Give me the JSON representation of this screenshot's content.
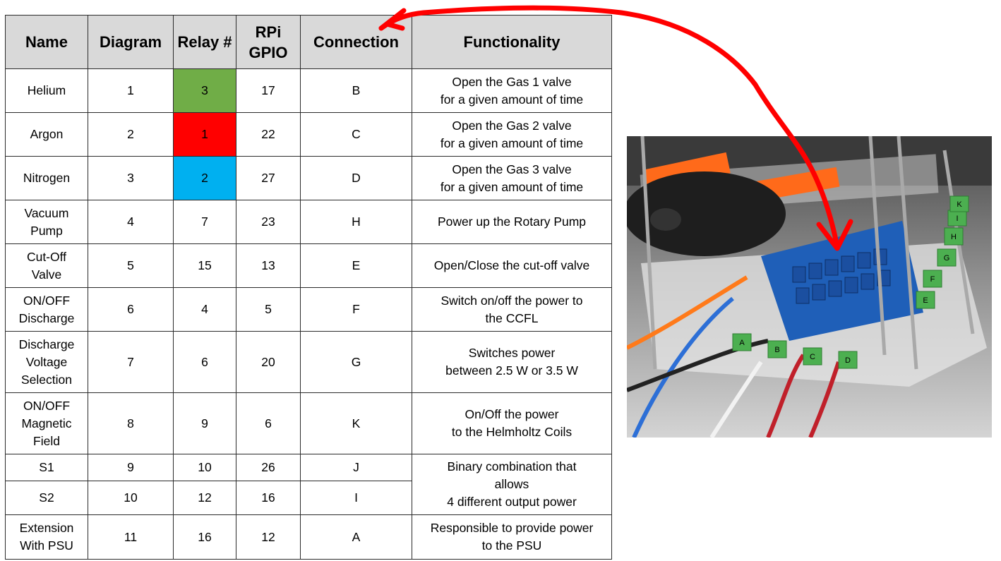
{
  "table": {
    "headers": [
      "Name",
      "Diagram",
      "Relay\n#",
      "RPi\nGPIO",
      "Connection",
      "Functionality"
    ],
    "rows": [
      {
        "name": "Helium",
        "diagram": "1",
        "relay": "3",
        "gpio": "17",
        "connection": "B",
        "functionality": "Open the Gas 1 valve\nfor a given amount of time",
        "relay_color": "#70ad47"
      },
      {
        "name": "Argon",
        "diagram": "2",
        "relay": "1",
        "gpio": "22",
        "connection": "C",
        "functionality": "Open the Gas 2 valve\nfor a given amount of time",
        "relay_color": "#ff0000"
      },
      {
        "name": "Nitrogen",
        "diagram": "3",
        "relay": "2",
        "gpio": "27",
        "connection": "D",
        "functionality": "Open the Gas 3 valve\nfor a given amount of time",
        "relay_color": "#00b0f0"
      },
      {
        "name": "Vacuum\nPump",
        "diagram": "4",
        "relay": "7",
        "gpio": "23",
        "connection": "H",
        "functionality": "Power up the Rotary Pump"
      },
      {
        "name": "Cut-Off\nValve",
        "diagram": "5",
        "relay": "15",
        "gpio": "13",
        "connection": "E",
        "functionality": "Open/Close the cut-off valve"
      },
      {
        "name": "ON/OFF\nDischarge",
        "diagram": "6",
        "relay": "4",
        "gpio": "5",
        "connection": "F",
        "functionality": "Switch on/off the power to\nthe CCFL"
      },
      {
        "name": "Discharge\nVoltage\nSelection",
        "diagram": "7",
        "relay": "6",
        "gpio": "20",
        "connection": "G",
        "functionality": "Switches power\nbetween 2.5 W or 3.5 W"
      },
      {
        "name": "ON/OFF\nMagnetic\nField",
        "diagram": "8",
        "relay": "9",
        "gpio": "6",
        "connection": "K",
        "functionality": "On/Off the power\nto the Helmholtz Coils"
      },
      {
        "name": "S1",
        "diagram": "9",
        "relay": "10",
        "gpio": "26",
        "connection": "J",
        "functionality": "Binary combination that\nallows\n4 different output power"
      },
      {
        "name": "S2",
        "diagram": "10",
        "relay": "12",
        "gpio": "16",
        "connection": "I"
      },
      {
        "name": "Extension\nWith PSU",
        "diagram": "11",
        "relay": "16",
        "gpio": "12",
        "connection": "A",
        "functionality": "Responsible to provide power\nto the PSU"
      }
    ]
  },
  "photo": {
    "connector_labels": [
      "A",
      "B",
      "C",
      "D",
      "E",
      "F",
      "G",
      "H",
      "I",
      "K"
    ],
    "arrow_color": "#ff0000"
  }
}
